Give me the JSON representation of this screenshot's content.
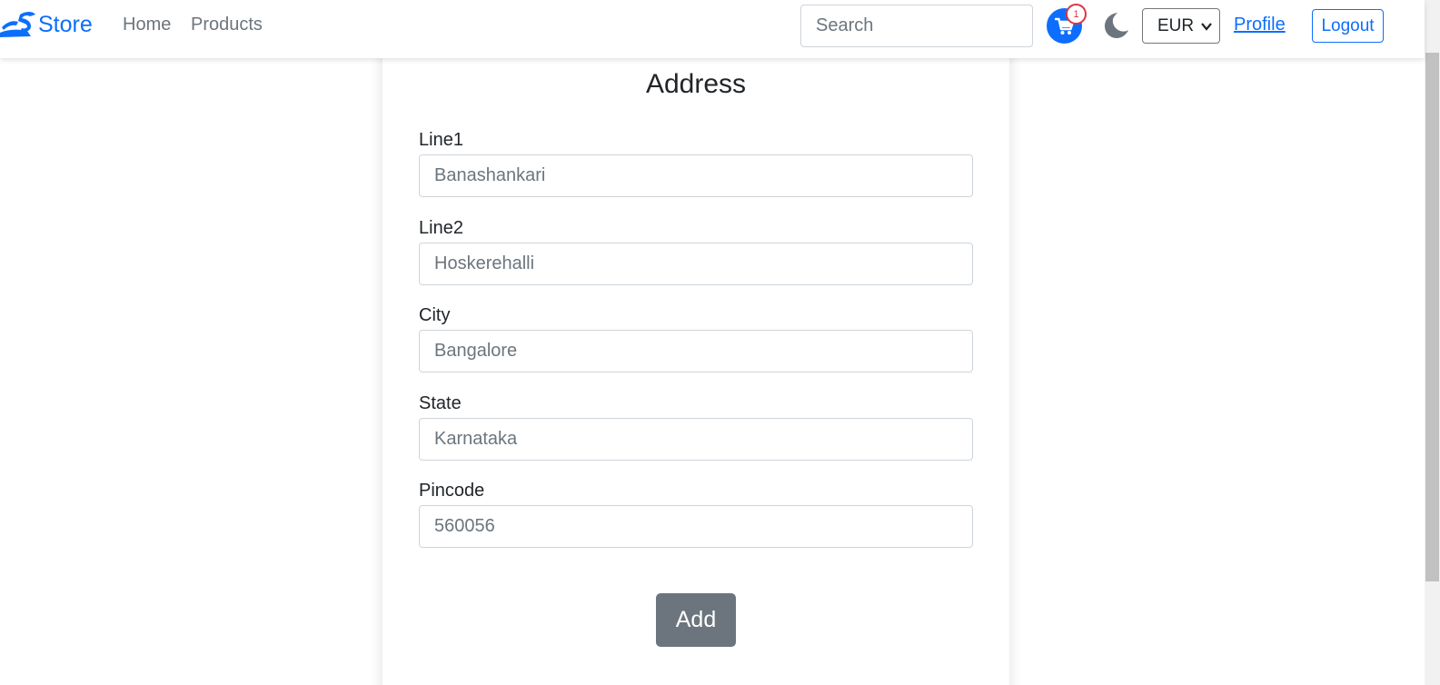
{
  "nav": {
    "brand": "Store",
    "home": "Home",
    "products": "Products",
    "search_placeholder": "Search",
    "cart_count": "1",
    "currency": "EUR",
    "profile": "Profile",
    "logout": "Logout"
  },
  "form": {
    "title": "Address",
    "fields": [
      {
        "label": "Line1",
        "placeholder": "Banashankari"
      },
      {
        "label": "Line2",
        "placeholder": "Hoskerehalli"
      },
      {
        "label": "City",
        "placeholder": "Bangalore"
      },
      {
        "label": "State",
        "placeholder": "Karnataka"
      },
      {
        "label": "Pincode",
        "placeholder": "560056"
      }
    ],
    "submit": "Add"
  },
  "colors": {
    "primary": "#0d6efd",
    "secondary": "#6c757d",
    "badge": "#dc3545"
  }
}
